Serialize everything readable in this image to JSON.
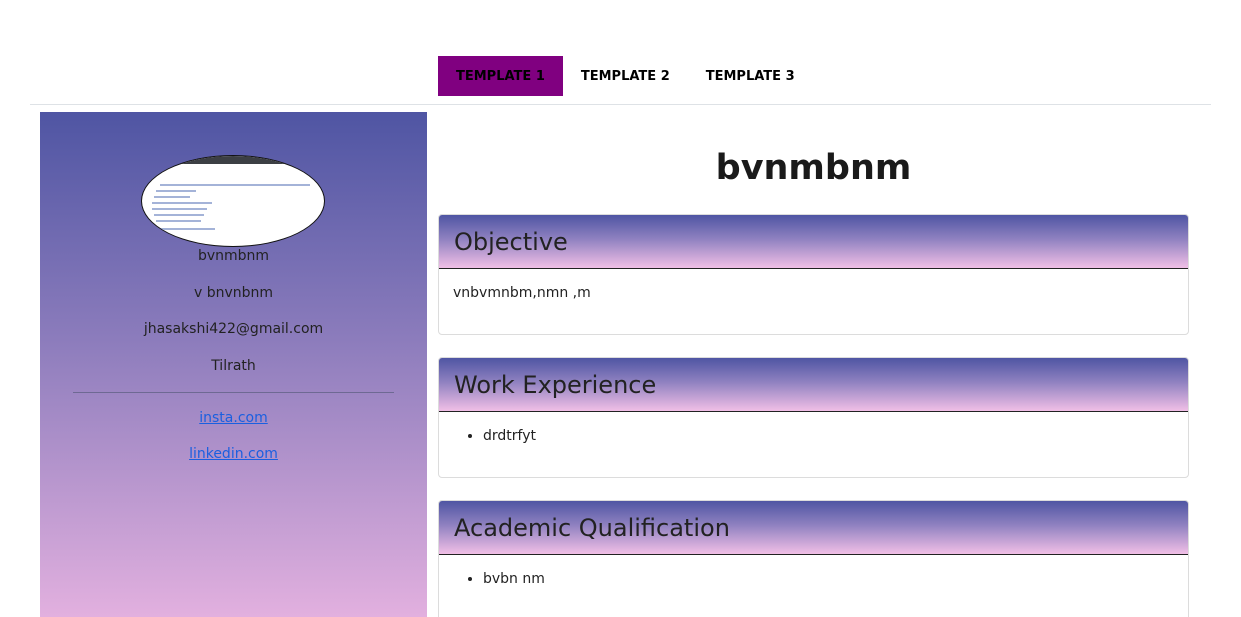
{
  "tabs": [
    {
      "label": "TEMPLATE 1",
      "active": true
    },
    {
      "label": "TEMPLATE 2",
      "active": false
    },
    {
      "label": "TEMPLATE 3",
      "active": false
    }
  ],
  "sidebar": {
    "name": "bvnmbnm",
    "subtitle": "v bnvnbnm",
    "email": "jhasakshi422@gmail.com",
    "location": "Tilrath",
    "links": [
      "insta.com",
      "linkedin.com"
    ]
  },
  "main": {
    "title": "bvnmbnm",
    "sections": [
      {
        "heading": "Objective",
        "text": "vnbvmnbm,nmn ,m"
      },
      {
        "heading": "Work Experience",
        "items": [
          "drdtrfyt"
        ]
      },
      {
        "heading": "Academic Qualification",
        "items": [
          "bvbn nm"
        ]
      }
    ]
  },
  "colors": {
    "active_tab": "#800080",
    "gradient_top": "#4f55a3",
    "gradient_bottom": "#e2b0df",
    "link": "#1a5fe0"
  }
}
